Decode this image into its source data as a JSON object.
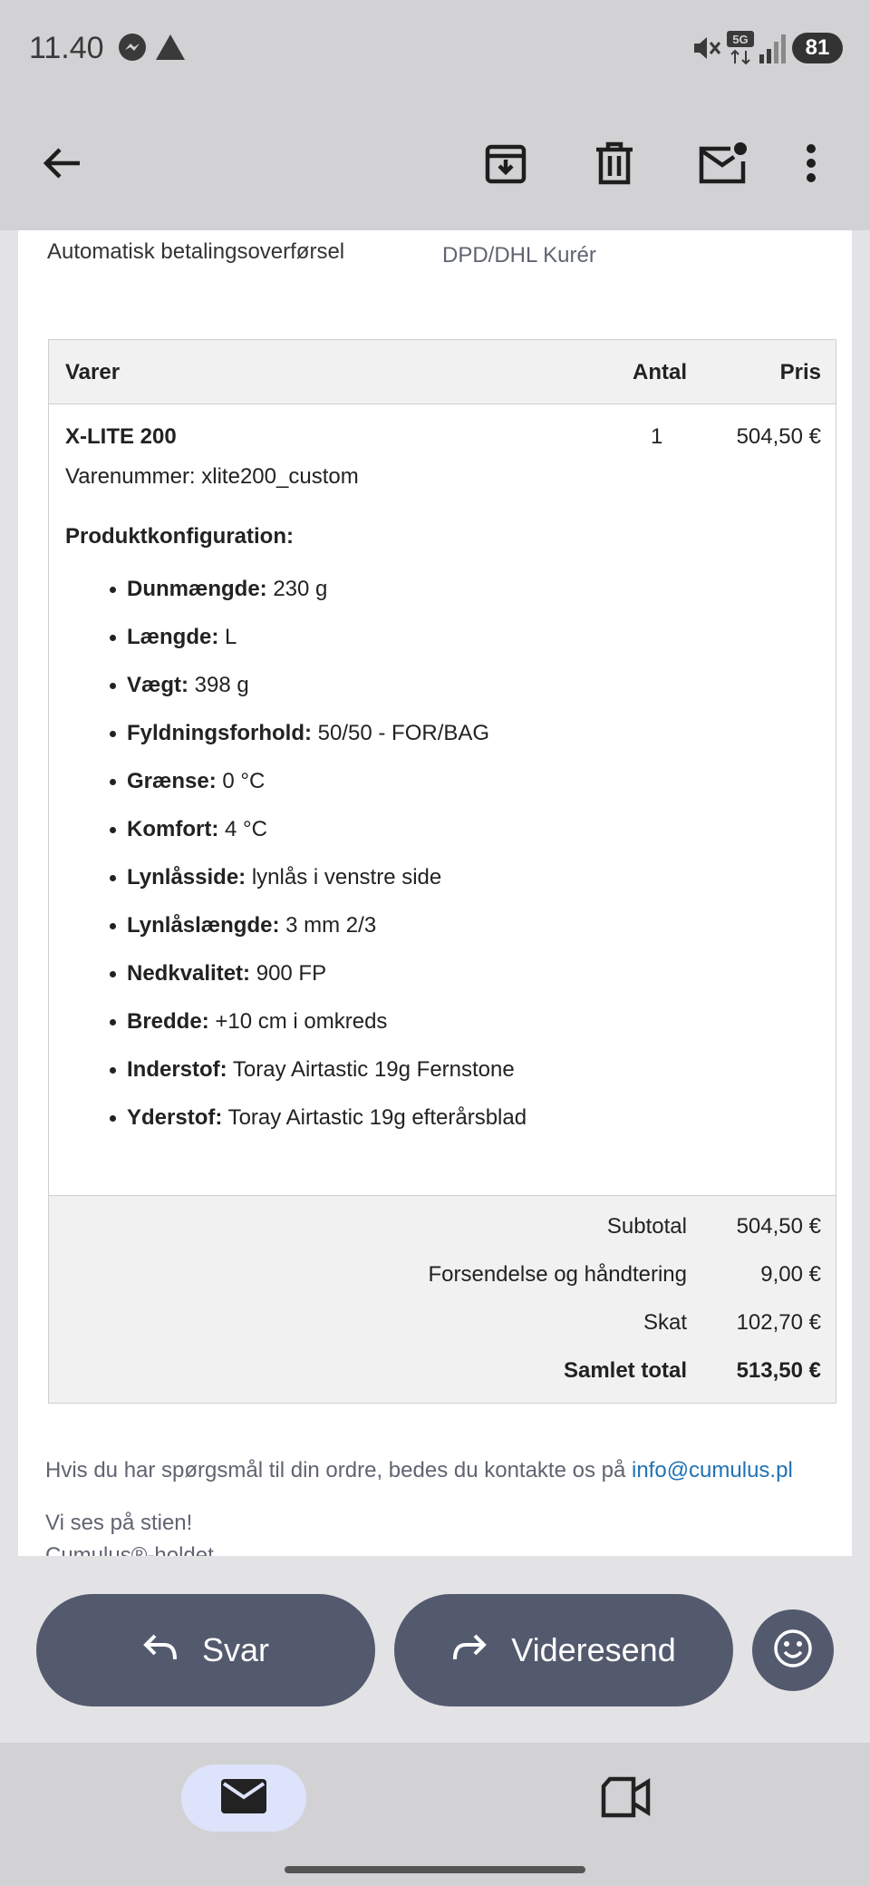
{
  "status_bar": {
    "time": "11.40",
    "battery": "81",
    "network": "5G"
  },
  "payment": {
    "label": "Automatisk betalingsoverførsel",
    "shipping": "DPD/DHL Kurér"
  },
  "order": {
    "headers": {
      "items": "Varer",
      "qty": "Antal",
      "price": "Pris"
    },
    "product": {
      "name": "X-LITE 200",
      "qty": "1",
      "price": "504,50 €",
      "sku": "Varenummer: xlite200_custom",
      "config_title": "Produktkonfiguration:"
    },
    "specs": [
      {
        "label": "Dunmængde:",
        "value": "230 g"
      },
      {
        "label": "Længde:",
        "value": "L"
      },
      {
        "label": "Vægt:",
        "value": "398 g"
      },
      {
        "label": "Fyldningsforhold:",
        "value": "50/50 - FOR/BAG"
      },
      {
        "label": "Grænse:",
        "value": "0 °C"
      },
      {
        "label": "Komfort:",
        "value": "4 °C"
      },
      {
        "label": "Lynlåsside:",
        "value": "lynlås i venstre side"
      },
      {
        "label": "Lynlåslængde:",
        "value": "3 mm 2/3"
      },
      {
        "label": "Nedkvalitet:",
        "value": "900 FP"
      },
      {
        "label": "Bredde:",
        "value": "+10 cm i omkreds"
      },
      {
        "label": "Inderstof:",
        "value": "Toray Airtastic 19g Fernstone"
      },
      {
        "label": "Yderstof:",
        "value": "Toray Airtastic 19g efterårsblad"
      }
    ],
    "totals": [
      {
        "label": "Subtotal",
        "value": "504,50 €"
      },
      {
        "label": "Forsendelse og håndtering",
        "value": "9,00 €"
      },
      {
        "label": "Skat",
        "value": "102,70 €"
      },
      {
        "label": "Samlet total",
        "value": "513,50 €"
      }
    ]
  },
  "footer": {
    "contact_text": "Hvis du har spørgsmål til din ordre, bedes du kontakte os på ",
    "contact_email": "info@cumulus.pl",
    "signoff_1": "Vi ses på stien!",
    "signoff_2": "Cumulus®-holdet"
  },
  "actions": {
    "reply": "Svar",
    "forward": "Videresend"
  },
  "icons": [
    "back-arrow-icon",
    "archive-icon",
    "delete-icon",
    "mark-unread-icon",
    "more-vert-icon",
    "reply-icon",
    "forward-icon",
    "emoji-icon",
    "mail-icon",
    "meet-icon"
  ],
  "colors": {
    "toolbar_bg": "#d2d2d4",
    "button_bg": "#545a6e",
    "link": "#1f72b5",
    "nav_active": "#dde3fb"
  }
}
